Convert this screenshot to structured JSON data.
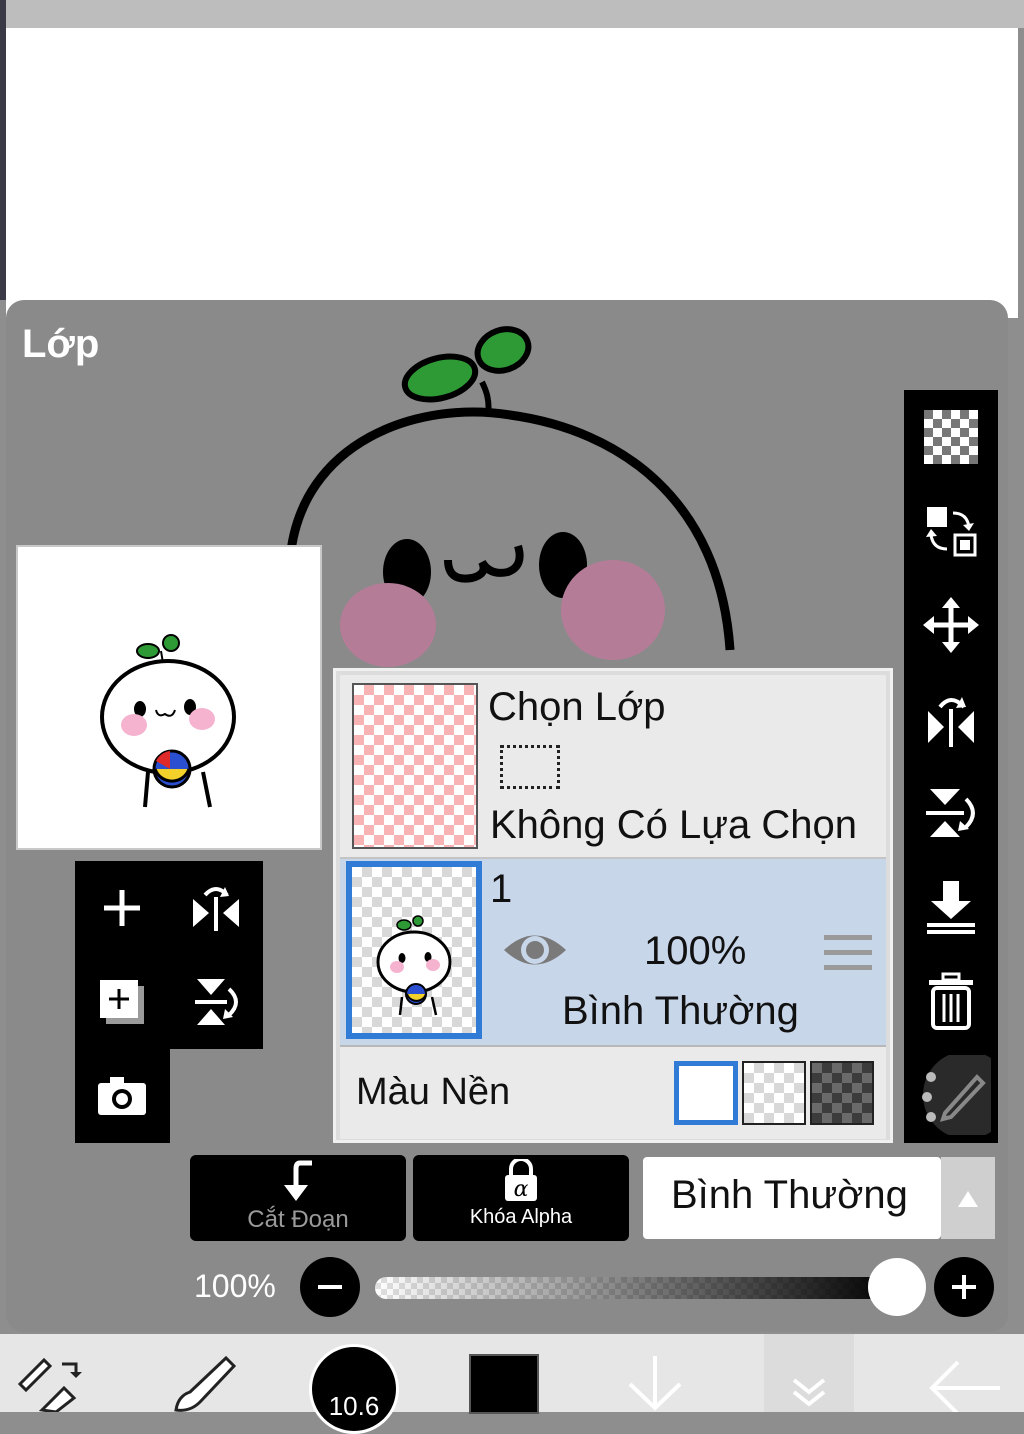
{
  "panel": {
    "title": "Lớp"
  },
  "layers": {
    "selection_layer": {
      "title": "Chọn Lớp",
      "status": "Không Có Lựa Chọn"
    },
    "layer_1": {
      "name": "1",
      "opacity": "100%",
      "blend": "Bình Thường"
    },
    "background": {
      "label": "Màu Nền",
      "selected_option": "white"
    }
  },
  "buttons": {
    "clipping": "Cắt Đoạn",
    "alpha_lock": "Khóa Alpha"
  },
  "blend_mode": {
    "value": "Bình Thường"
  },
  "opacity": {
    "label": "100%",
    "value": 1.0
  },
  "bottom_toolbar": {
    "brush_size": "10.6",
    "color": "#000000"
  },
  "colors": {
    "panel_bg": "#8a8a8a",
    "selected_layer_bg": "#c8d6ea",
    "accent": "#2f7bd6",
    "toolbar_bg": "#000000"
  }
}
